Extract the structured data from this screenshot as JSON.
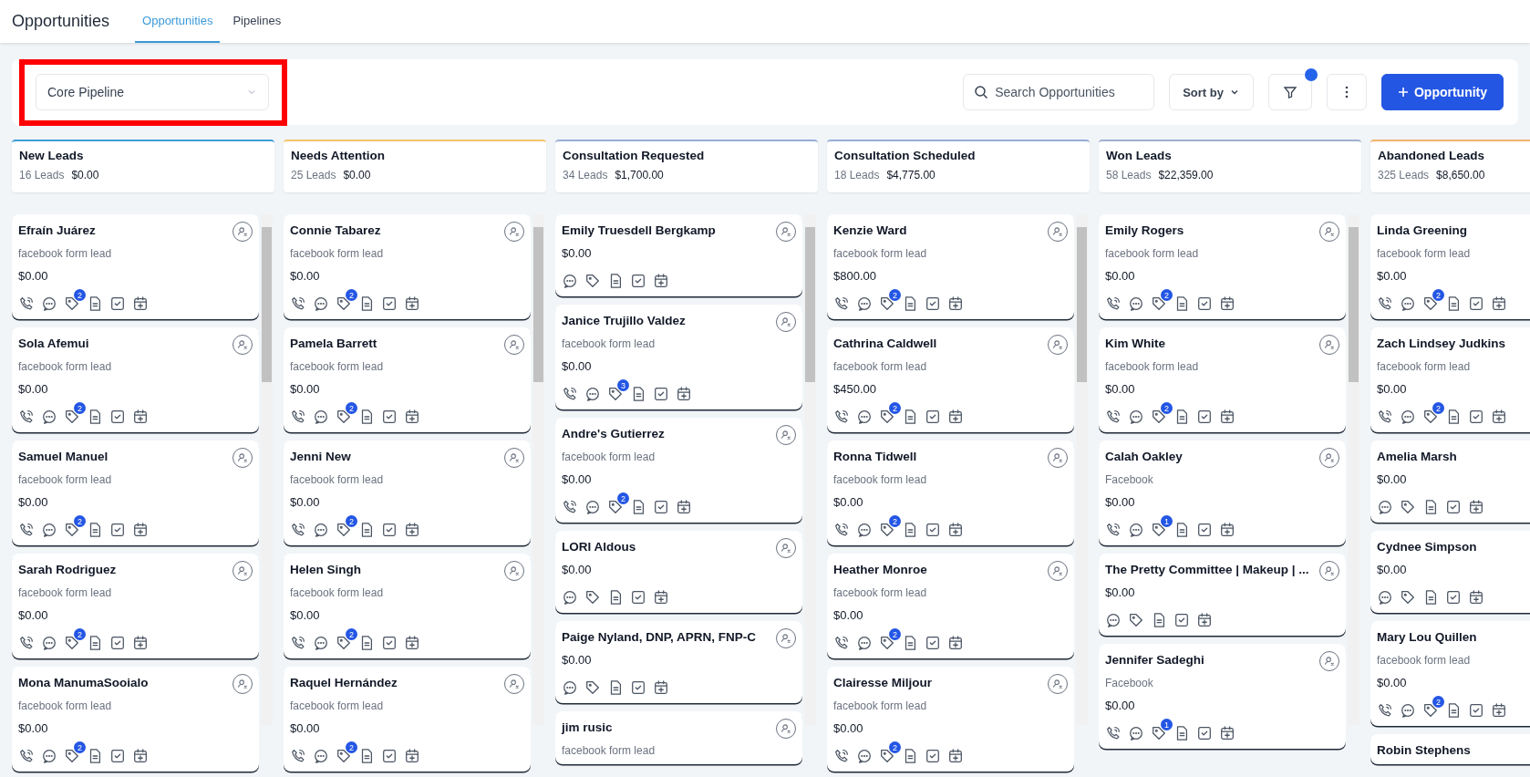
{
  "header": {
    "title": "Opportunities",
    "tabs": [
      {
        "label": "Opportunities",
        "selected": true
      },
      {
        "label": "Pipelines",
        "selected": false
      }
    ]
  },
  "toolbar": {
    "pipeline_select": {
      "value": "Core Pipeline",
      "highlighted": true
    },
    "search": {
      "placeholder": "Search Opportunities"
    },
    "sort_button": "Sort by",
    "filter_active": true,
    "add_button": "Opportunity"
  },
  "columns": [
    {
      "title": "New Leads",
      "count": "16 Leads",
      "total": "$0.00",
      "color": "#3d9fd8",
      "cards": [
        {
          "name": "Efraín Juárez",
          "source": "facebook form lead",
          "amount": "$0.00",
          "phone": true,
          "badge": "2"
        },
        {
          "name": "Sola Afemui",
          "source": "facebook form lead",
          "amount": "$0.00",
          "phone": true,
          "badge": "2"
        },
        {
          "name": "Samuel Manuel",
          "source": "facebook form lead",
          "amount": "$0.00",
          "phone": true,
          "badge": "2"
        },
        {
          "name": "Sarah Rodriguez",
          "source": "facebook form lead",
          "amount": "$0.00",
          "phone": true,
          "badge": "2"
        },
        {
          "name": "Mona ManumaSooialo",
          "source": "facebook form lead",
          "amount": "$0.00",
          "phone": true,
          "badge": "2"
        }
      ]
    },
    {
      "title": "Needs Attention",
      "count": "25 Leads",
      "total": "$0.00",
      "color": "#f2c46d",
      "cards": [
        {
          "name": "Connie Tabarez",
          "source": "facebook form lead",
          "amount": "$0.00",
          "phone": true,
          "badge": "2"
        },
        {
          "name": "Pamela Barrett",
          "source": "facebook form lead",
          "amount": "$0.00",
          "phone": true,
          "badge": "2"
        },
        {
          "name": "Jenni New",
          "source": "facebook form lead",
          "amount": "$0.00",
          "phone": true,
          "badge": "2"
        },
        {
          "name": "Helen Singh",
          "source": "facebook form lead",
          "amount": "$0.00",
          "phone": true,
          "badge": "2"
        },
        {
          "name": "Raquel Hernández",
          "source": "facebook form lead",
          "amount": "$0.00",
          "phone": true,
          "badge": "2"
        }
      ]
    },
    {
      "title": "Consultation Requested",
      "count": "34 Leads",
      "total": "$1,700.00",
      "color": "#98add6",
      "cards": [
        {
          "name": "Emily Truesdell Bergkamp",
          "amount": "$0.00",
          "phone": false
        },
        {
          "name": "Janice Trujillo Valdez",
          "source": "facebook form lead",
          "amount": "$0.00",
          "phone": true,
          "badge": "3"
        },
        {
          "name": "Andre's Gutierrez",
          "source": "facebook form lead",
          "amount": "$0.00",
          "phone": true,
          "badge": "2"
        },
        {
          "name": "LORI Aldous",
          "amount": "$0.00",
          "phone": false
        },
        {
          "name": "Paige Nyland, DNP, APRN, FNP-C",
          "amount": "$0.00",
          "phone": false
        },
        {
          "name": "jim rusic",
          "source": "facebook form lead"
        }
      ]
    },
    {
      "title": "Consultation Scheduled",
      "count": "18 Leads",
      "total": "$4,775.00",
      "color": "#98add6",
      "cards": [
        {
          "name": "Kenzie Ward",
          "source": "facebook form lead",
          "amount": "$800.00",
          "phone": true,
          "badge": "2"
        },
        {
          "name": "Cathrina Caldwell",
          "source": "facebook form lead",
          "amount": "$450.00",
          "phone": true,
          "badge": "2"
        },
        {
          "name": "Ronna Tidwell",
          "source": "facebook form lead",
          "amount": "$0.00",
          "phone": true,
          "badge": "2"
        },
        {
          "name": "Heather Monroe",
          "source": "facebook form lead",
          "amount": "$0.00",
          "phone": true,
          "badge": "2"
        },
        {
          "name": "Clairesse Miljour",
          "source": "facebook form lead",
          "amount": "$0.00",
          "phone": true,
          "badge": "2"
        }
      ]
    },
    {
      "title": "Won Leads",
      "count": "58 Leads",
      "total": "$22,359.00",
      "color": "#9fb0d0",
      "cards": [
        {
          "name": "Emily Rogers",
          "source": "facebook form lead",
          "amount": "$0.00",
          "phone": true,
          "badge": "2"
        },
        {
          "name": "Kim White",
          "source": "facebook form lead",
          "amount": "$0.00",
          "phone": true,
          "badge": "2"
        },
        {
          "name": "Calah Oakley",
          "source": "Facebook",
          "amount": "$0.00",
          "phone": true,
          "badge": "1"
        },
        {
          "name": "The Pretty Committee | Makeup | ...",
          "amount": "$0.00",
          "phone": false
        },
        {
          "name": "Jennifer Sadeghi",
          "source": "Facebook",
          "amount": "$0.00",
          "phone": true,
          "badge": "1"
        }
      ]
    },
    {
      "title": "Abandoned Leads",
      "count": "325 Leads",
      "total": "$8,650.00",
      "color": "#f2b36d",
      "cards": [
        {
          "name": "Linda Greening",
          "source": "facebook form lead",
          "amount": "$0.00",
          "phone": true,
          "badge": "2"
        },
        {
          "name": "Zach Lindsey Judkins",
          "source": "facebook form lead",
          "amount": "$0.00",
          "phone": true,
          "badge": "2"
        },
        {
          "name": "Amelia Marsh",
          "amount": "$0.00",
          "phone": false
        },
        {
          "name": "Cydnee Simpson",
          "amount": "$0.00",
          "phone": false
        },
        {
          "name": "Mary Lou Quillen",
          "source": "facebook form lead",
          "amount": "$0.00",
          "phone": true,
          "badge": "2"
        },
        {
          "name": "Robin Stephens"
        }
      ]
    }
  ]
}
